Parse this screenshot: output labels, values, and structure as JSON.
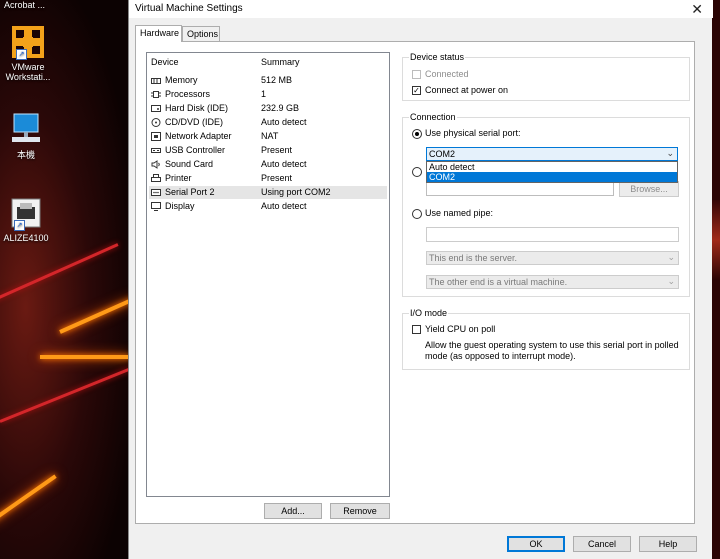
{
  "desktop": {
    "top_title": "Acrobat ...",
    "icons": [
      {
        "name": "VMware\nWorkstati...",
        "icon": "vmware-icon"
      },
      {
        "name": "本機",
        "icon": "computer-icon"
      },
      {
        "name": "ALIZE4100",
        "icon": "printer-app-icon"
      }
    ]
  },
  "dialog": {
    "title": "Virtual Machine Settings",
    "close_glyph": "✕",
    "tabs": [
      "Hardware",
      "Options"
    ],
    "device_list": {
      "headers": {
        "device": "Device",
        "summary": "Summary"
      },
      "rows": [
        {
          "device": "Memory",
          "summary": "512 MB",
          "icon": "memory-icon"
        },
        {
          "device": "Processors",
          "summary": "1",
          "icon": "processor-icon"
        },
        {
          "device": "Hard Disk (IDE)",
          "summary": "232.9 GB",
          "icon": "hard-disk-icon"
        },
        {
          "device": "CD/DVD (IDE)",
          "summary": "Auto detect",
          "icon": "cd-dvd-icon"
        },
        {
          "device": "Network Adapter",
          "summary": "NAT",
          "icon": "network-icon"
        },
        {
          "device": "USB Controller",
          "summary": "Present",
          "icon": "usb-icon"
        },
        {
          "device": "Sound Card",
          "summary": "Auto detect",
          "icon": "sound-icon"
        },
        {
          "device": "Printer",
          "summary": "Present",
          "icon": "printer-icon"
        },
        {
          "device": "Serial Port 2",
          "summary": "Using port COM2",
          "icon": "serial-port-icon",
          "selected": true
        },
        {
          "device": "Display",
          "summary": "Auto detect",
          "icon": "display-icon"
        }
      ]
    },
    "add_button": "Add...",
    "remove_button": "Remove",
    "device_status": {
      "label": "Device status",
      "connected": "Connected",
      "connect_at_power_on": "Connect at power on"
    },
    "connection": {
      "label": "Connection",
      "use_physical": "Use physical serial port:",
      "selected_port": "COM2",
      "dropdown_options": [
        "Auto detect",
        "COM2"
      ],
      "browse_button": "Browse...",
      "use_named_pipe": "Use named pipe:",
      "pipe_end": "This end is the server.",
      "other_end": "The other end is a virtual machine."
    },
    "io_mode": {
      "label": "I/O mode",
      "yield_cpu": "Yield CPU on poll",
      "description": "Allow the guest operating system to use this serial port in polled mode (as opposed to interrupt mode)."
    },
    "ok_button": "OK",
    "cancel_button": "Cancel",
    "help_button": "Help"
  }
}
